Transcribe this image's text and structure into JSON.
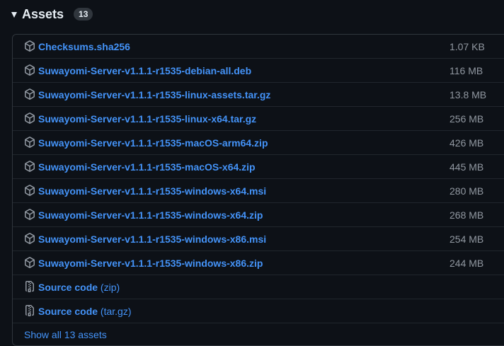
{
  "header": {
    "title": "Assets",
    "count": "13"
  },
  "assets": [
    {
      "name": "Checksums.sha256",
      "size": "1.07 KB"
    },
    {
      "name": "Suwayomi-Server-v1.1.1-r1535-debian-all.deb",
      "size": "116 MB"
    },
    {
      "name": "Suwayomi-Server-v1.1.1-r1535-linux-assets.tar.gz",
      "size": "13.8 MB"
    },
    {
      "name": "Suwayomi-Server-v1.1.1-r1535-linux-x64.tar.gz",
      "size": "256 MB"
    },
    {
      "name": "Suwayomi-Server-v1.1.1-r1535-macOS-arm64.zip",
      "size": "426 MB"
    },
    {
      "name": "Suwayomi-Server-v1.1.1-r1535-macOS-x64.zip",
      "size": "445 MB"
    },
    {
      "name": "Suwayomi-Server-v1.1.1-r1535-windows-x64.msi",
      "size": "280 MB"
    },
    {
      "name": "Suwayomi-Server-v1.1.1-r1535-windows-x64.zip",
      "size": "268 MB"
    },
    {
      "name": "Suwayomi-Server-v1.1.1-r1535-windows-x86.msi",
      "size": "254 MB"
    },
    {
      "name": "Suwayomi-Server-v1.1.1-r1535-windows-x86.zip",
      "size": "244 MB"
    }
  ],
  "source_code": [
    {
      "label": "Source code",
      "suffix": "(zip)"
    },
    {
      "label": "Source code",
      "suffix": "(tar.gz)"
    }
  ],
  "show_all_label": "Show all 13 assets",
  "colors": {
    "background": "#0d1117",
    "link": "#4493f8",
    "muted": "#9198a1",
    "border": "#30363d"
  }
}
